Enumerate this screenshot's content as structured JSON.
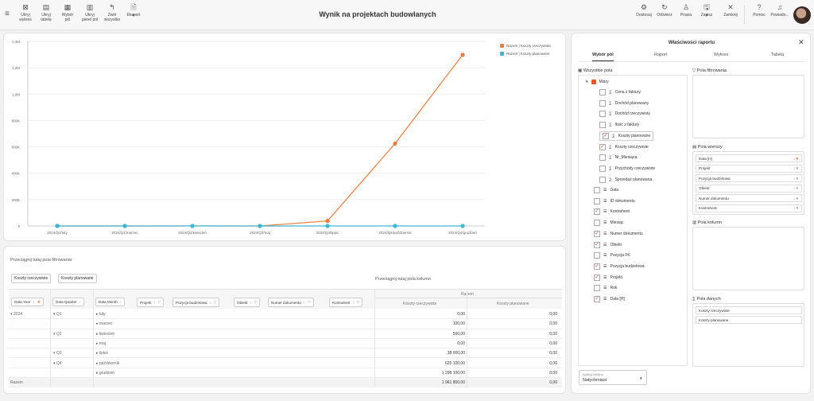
{
  "toolbar": {
    "left_buttons": [
      {
        "label1": "Ukryj",
        "label2": "wykres",
        "icon": "chart-hide-icon"
      },
      {
        "label1": "Ukryj",
        "label2": "tabelę",
        "icon": "table-hide-icon"
      },
      {
        "label1": "Wybór",
        "label2": "pól",
        "icon": "fields-icon"
      },
      {
        "label1": "Ukryj",
        "label2": "panel pól",
        "icon": "panel-icon"
      },
      {
        "label1": "Zwiń",
        "label2": "wszystko",
        "icon": "collapse-icon"
      },
      {
        "label1": "Eksport",
        "label2": "",
        "icon": "export-icon"
      }
    ],
    "title": "Wynik na projektach budowlanych",
    "right_buttons": [
      {
        "label": "Dostosuj",
        "icon": "customize-icon"
      },
      {
        "label": "Odśwież",
        "icon": "refresh-icon"
      },
      {
        "label": "Prawa",
        "icon": "user-icon"
      },
      {
        "label": "Zapisz",
        "icon": "save-icon"
      },
      {
        "label": "Zamknij",
        "icon": "close-icon"
      },
      {
        "label": "Pomoc",
        "icon": "help-icon"
      },
      {
        "label": "Powiado...",
        "icon": "bell-icon"
      }
    ]
  },
  "chart_data": {
    "type": "line",
    "categories": [
      "2024/Q1/luty",
      "2024/Q1/marzec",
      "2024/Q2/kwiecień",
      "2024/Q2/maj",
      "2024/Q3/lipiec",
      "2024/Q4/październik",
      "2024/Q4/grudzień"
    ],
    "series": [
      {
        "name": "Razem | Koszty rzeczywiste",
        "color": "#f07c3b",
        "values": [
          0,
          100,
          500,
          0,
          38000,
          625100,
          1298100
        ]
      },
      {
        "name": "Razem | Koszty planowane",
        "color": "#3bb8d8",
        "values": [
          0,
          0,
          0,
          0,
          0,
          0,
          0
        ]
      }
    ],
    "y_ticks": [
      "0",
      "200K",
      "400K",
      "600K",
      "800K",
      "1,0M",
      "1,2M",
      "1,4M"
    ],
    "ylim": [
      0,
      1400000
    ],
    "legend": "top-right"
  },
  "pivot": {
    "filter_hint": "Przeciągnij tutaj pola filtrowania",
    "column_hint": "Przeciągnij tutaj pola kolumn",
    "value_chips": [
      "Koszty rzeczywiste",
      "Koszty planowane"
    ],
    "row_headers": [
      "Data Year",
      "Data Quarter",
      "Data Month",
      "Projekt",
      "Pozycja budżetowa",
      "Obiekt",
      "Numer dokumentu",
      "Kontrahent"
    ],
    "razem": "Razem",
    "col_headers": [
      "Koszty rzeczywiste",
      "Koszty planowane"
    ],
    "rows": [
      {
        "year": "2024",
        "quarter": "Q1",
        "month": "luty",
        "v1": "0,00",
        "v2": "0,00"
      },
      {
        "year": "",
        "quarter": "",
        "month": "marzec",
        "v1": "100,00",
        "v2": "0,00"
      },
      {
        "year": "",
        "quarter": "Q2",
        "month": "kwiecień",
        "v1": "500,00",
        "v2": "0,00"
      },
      {
        "year": "",
        "quarter": "",
        "month": "maj",
        "v1": "0,00",
        "v2": "0,00"
      },
      {
        "year": "",
        "quarter": "Q3",
        "month": "lipiec",
        "v1": "38 000,00",
        "v2": "0,00"
      },
      {
        "year": "",
        "quarter": "Q4",
        "month": "październik",
        "v1": "625 100,00",
        "v2": "0,00"
      },
      {
        "year": "",
        "quarter": "",
        "month": "grudzień",
        "v1": "1 298 100,00",
        "v2": "0,00"
      }
    ],
    "total": {
      "label": "Razem",
      "v1": "1 961 800,00",
      "v2": "0,00"
    }
  },
  "props": {
    "title": "Właściwości raportu",
    "tabs": [
      "Wybór pól",
      "Raport",
      "Wykres",
      "Tabela"
    ],
    "all_fields": "Wszystkie pola",
    "measures": "Miary",
    "measure_items": [
      {
        "label": "Cena z faktury",
        "checked": false
      },
      {
        "label": "Dochód planowany",
        "checked": false
      },
      {
        "label": "Dochód rzeczywisty",
        "checked": false
      },
      {
        "label": "Ilość z faktury",
        "checked": false
      },
      {
        "label": "Koszty planowane",
        "checked": true
      },
      {
        "label": "Koszty rzeczywiste",
        "checked": true
      },
      {
        "label": "Nr_Miesiąca",
        "checked": false
      },
      {
        "label": "Przychody rzeczywiste",
        "checked": false
      },
      {
        "label": "Sprzedaż planowana",
        "checked": false
      }
    ],
    "dim_items": [
      {
        "label": "Data",
        "checked": false
      },
      {
        "label": "ID dokumentu",
        "checked": false
      },
      {
        "label": "Kontrahent",
        "checked": true
      },
      {
        "label": "Miesiąc",
        "checked": false
      },
      {
        "label": "Numer dokumentu",
        "checked": true
      },
      {
        "label": "Obiekt",
        "checked": true
      },
      {
        "label": "Pozycja FK",
        "checked": false
      },
      {
        "label": "Pozycja budżetowa",
        "checked": true
      },
      {
        "label": "Projekt",
        "checked": true
      },
      {
        "label": "Rok",
        "checked": false
      },
      {
        "label": "Data [H]",
        "checked": true
      }
    ],
    "filter_fields": "Pola filtrowania",
    "row_fields": "Pola wierszy",
    "row_field_items": [
      "Data [H]",
      "Projekt",
      "Pozycja budżetowa",
      "Obiekt",
      "Numer dokumentu",
      "Kontrahent"
    ],
    "col_fields": "Pola kolumn",
    "data_fields": "Pola danych",
    "data_field_items": [
      "Koszty rzeczywiste",
      "Koszty planowane"
    ],
    "apply_label": "Aplikuj zmiany",
    "apply_value": "Natychmiast"
  }
}
